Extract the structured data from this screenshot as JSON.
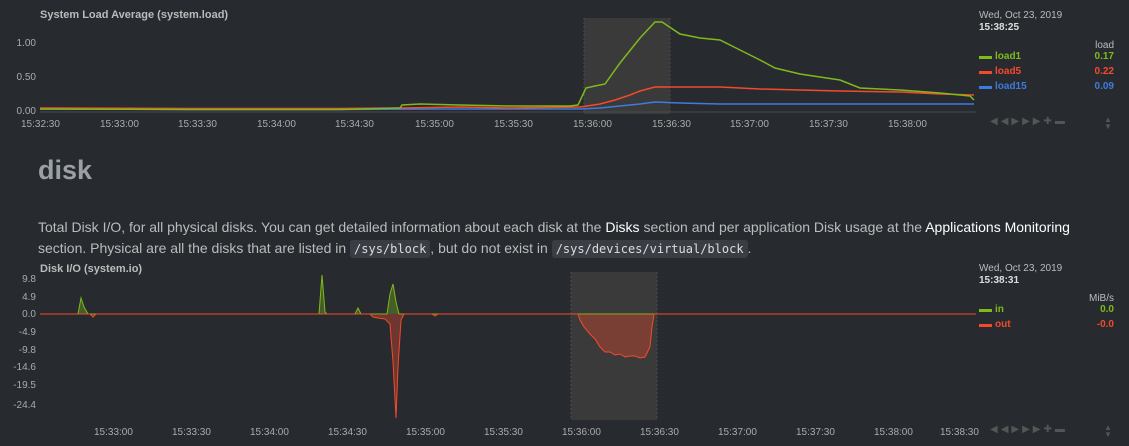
{
  "load_chart": {
    "title": "System Load Average (system.load)",
    "legend": {
      "date": "Wed, Oct 23, 2019",
      "time": "15:38:25",
      "units": "load",
      "dims": [
        {
          "name": "load1",
          "value": "0.17",
          "color": "#7fba1a"
        },
        {
          "name": "load5",
          "value": "0.22",
          "color": "#f44a2a"
        },
        {
          "name": "load15",
          "value": "0.09",
          "color": "#3e7bde"
        }
      ]
    },
    "y_ticks": [
      "1.00",
      "0.50",
      "0.00"
    ],
    "x_ticks": [
      "15:32:30",
      "15:33:00",
      "15:33:30",
      "15:34:00",
      "15:34:30",
      "15:35:00",
      "15:35:30",
      "15:36:00",
      "15:36:30",
      "15:37:00",
      "15:37:30",
      "15:38:00"
    ]
  },
  "disk_section": {
    "title": "disk",
    "desc_1": "Total Disk I/O, for all physical disks. You can get detailed information about each disk at the ",
    "link_disks": "Disks",
    "desc_2": " section and per application Disk usage at the ",
    "link_apps": "Applications Monitoring",
    "desc_3": " section. Physical are all the disks that are listed in ",
    "code_1": "/sys/block",
    "desc_4": ", but do not exist in ",
    "code_2": "/sys/devices/virtual/block",
    "desc_5": "."
  },
  "io_chart": {
    "title": "Disk I/O (system.io)",
    "legend": {
      "date": "Wed, Oct 23, 2019",
      "time": "15:38:31",
      "units": "MiB/s",
      "dims": [
        {
          "name": "in",
          "value": "0.0",
          "color": "#7fba1a"
        },
        {
          "name": "out",
          "value": "-0.0",
          "color": "#f44a2a"
        }
      ]
    },
    "y_ticks": [
      "9.8",
      "4.9",
      "0.0",
      "-4.9",
      "-9.8",
      "-14.6",
      "-19.5",
      "-24.4"
    ],
    "x_ticks": [
      "15:33:00",
      "15:33:30",
      "15:34:00",
      "15:34:30",
      "15:35:00",
      "15:35:30",
      "15:36:00",
      "15:36:30",
      "15:37:00",
      "15:37:30",
      "15:38:00",
      "15:38:30"
    ]
  },
  "colors": {
    "background": "#272b30",
    "highlight": "#3a3a3a",
    "in": "#7fba1a",
    "out": "#f44a2a"
  }
}
